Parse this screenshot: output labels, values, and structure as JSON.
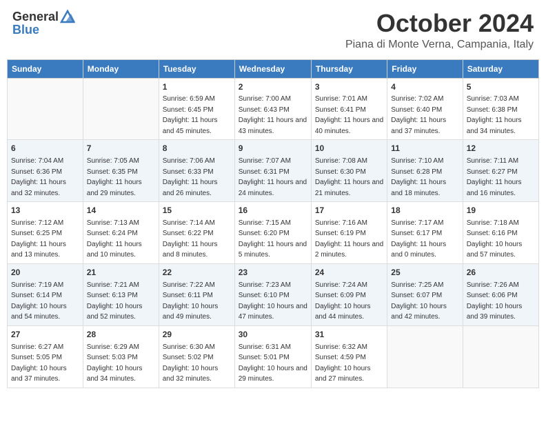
{
  "header": {
    "logo_general": "General",
    "logo_blue": "Blue",
    "month_title": "October 2024",
    "location": "Piana di Monte Verna, Campania, Italy"
  },
  "weekdays": [
    "Sunday",
    "Monday",
    "Tuesday",
    "Wednesday",
    "Thursday",
    "Friday",
    "Saturday"
  ],
  "weeks": [
    [
      {
        "day": "",
        "sunrise": "",
        "sunset": "",
        "daylight": ""
      },
      {
        "day": "",
        "sunrise": "",
        "sunset": "",
        "daylight": ""
      },
      {
        "day": "1",
        "sunrise": "Sunrise: 6:59 AM",
        "sunset": "Sunset: 6:45 PM",
        "daylight": "Daylight: 11 hours and 45 minutes."
      },
      {
        "day": "2",
        "sunrise": "Sunrise: 7:00 AM",
        "sunset": "Sunset: 6:43 PM",
        "daylight": "Daylight: 11 hours and 43 minutes."
      },
      {
        "day": "3",
        "sunrise": "Sunrise: 7:01 AM",
        "sunset": "Sunset: 6:41 PM",
        "daylight": "Daylight: 11 hours and 40 minutes."
      },
      {
        "day": "4",
        "sunrise": "Sunrise: 7:02 AM",
        "sunset": "Sunset: 6:40 PM",
        "daylight": "Daylight: 11 hours and 37 minutes."
      },
      {
        "day": "5",
        "sunrise": "Sunrise: 7:03 AM",
        "sunset": "Sunset: 6:38 PM",
        "daylight": "Daylight: 11 hours and 34 minutes."
      }
    ],
    [
      {
        "day": "6",
        "sunrise": "Sunrise: 7:04 AM",
        "sunset": "Sunset: 6:36 PM",
        "daylight": "Daylight: 11 hours and 32 minutes."
      },
      {
        "day": "7",
        "sunrise": "Sunrise: 7:05 AM",
        "sunset": "Sunset: 6:35 PM",
        "daylight": "Daylight: 11 hours and 29 minutes."
      },
      {
        "day": "8",
        "sunrise": "Sunrise: 7:06 AM",
        "sunset": "Sunset: 6:33 PM",
        "daylight": "Daylight: 11 hours and 26 minutes."
      },
      {
        "day": "9",
        "sunrise": "Sunrise: 7:07 AM",
        "sunset": "Sunset: 6:31 PM",
        "daylight": "Daylight: 11 hours and 24 minutes."
      },
      {
        "day": "10",
        "sunrise": "Sunrise: 7:08 AM",
        "sunset": "Sunset: 6:30 PM",
        "daylight": "Daylight: 11 hours and 21 minutes."
      },
      {
        "day": "11",
        "sunrise": "Sunrise: 7:10 AM",
        "sunset": "Sunset: 6:28 PM",
        "daylight": "Daylight: 11 hours and 18 minutes."
      },
      {
        "day": "12",
        "sunrise": "Sunrise: 7:11 AM",
        "sunset": "Sunset: 6:27 PM",
        "daylight": "Daylight: 11 hours and 16 minutes."
      }
    ],
    [
      {
        "day": "13",
        "sunrise": "Sunrise: 7:12 AM",
        "sunset": "Sunset: 6:25 PM",
        "daylight": "Daylight: 11 hours and 13 minutes."
      },
      {
        "day": "14",
        "sunrise": "Sunrise: 7:13 AM",
        "sunset": "Sunset: 6:24 PM",
        "daylight": "Daylight: 11 hours and 10 minutes."
      },
      {
        "day": "15",
        "sunrise": "Sunrise: 7:14 AM",
        "sunset": "Sunset: 6:22 PM",
        "daylight": "Daylight: 11 hours and 8 minutes."
      },
      {
        "day": "16",
        "sunrise": "Sunrise: 7:15 AM",
        "sunset": "Sunset: 6:20 PM",
        "daylight": "Daylight: 11 hours and 5 minutes."
      },
      {
        "day": "17",
        "sunrise": "Sunrise: 7:16 AM",
        "sunset": "Sunset: 6:19 PM",
        "daylight": "Daylight: 11 hours and 2 minutes."
      },
      {
        "day": "18",
        "sunrise": "Sunrise: 7:17 AM",
        "sunset": "Sunset: 6:17 PM",
        "daylight": "Daylight: 11 hours and 0 minutes."
      },
      {
        "day": "19",
        "sunrise": "Sunrise: 7:18 AM",
        "sunset": "Sunset: 6:16 PM",
        "daylight": "Daylight: 10 hours and 57 minutes."
      }
    ],
    [
      {
        "day": "20",
        "sunrise": "Sunrise: 7:19 AM",
        "sunset": "Sunset: 6:14 PM",
        "daylight": "Daylight: 10 hours and 54 minutes."
      },
      {
        "day": "21",
        "sunrise": "Sunrise: 7:21 AM",
        "sunset": "Sunset: 6:13 PM",
        "daylight": "Daylight: 10 hours and 52 minutes."
      },
      {
        "day": "22",
        "sunrise": "Sunrise: 7:22 AM",
        "sunset": "Sunset: 6:11 PM",
        "daylight": "Daylight: 10 hours and 49 minutes."
      },
      {
        "day": "23",
        "sunrise": "Sunrise: 7:23 AM",
        "sunset": "Sunset: 6:10 PM",
        "daylight": "Daylight: 10 hours and 47 minutes."
      },
      {
        "day": "24",
        "sunrise": "Sunrise: 7:24 AM",
        "sunset": "Sunset: 6:09 PM",
        "daylight": "Daylight: 10 hours and 44 minutes."
      },
      {
        "day": "25",
        "sunrise": "Sunrise: 7:25 AM",
        "sunset": "Sunset: 6:07 PM",
        "daylight": "Daylight: 10 hours and 42 minutes."
      },
      {
        "day": "26",
        "sunrise": "Sunrise: 7:26 AM",
        "sunset": "Sunset: 6:06 PM",
        "daylight": "Daylight: 10 hours and 39 minutes."
      }
    ],
    [
      {
        "day": "27",
        "sunrise": "Sunrise: 6:27 AM",
        "sunset": "Sunset: 5:05 PM",
        "daylight": "Daylight: 10 hours and 37 minutes."
      },
      {
        "day": "28",
        "sunrise": "Sunrise: 6:29 AM",
        "sunset": "Sunset: 5:03 PM",
        "daylight": "Daylight: 10 hours and 34 minutes."
      },
      {
        "day": "29",
        "sunrise": "Sunrise: 6:30 AM",
        "sunset": "Sunset: 5:02 PM",
        "daylight": "Daylight: 10 hours and 32 minutes."
      },
      {
        "day": "30",
        "sunrise": "Sunrise: 6:31 AM",
        "sunset": "Sunset: 5:01 PM",
        "daylight": "Daylight: 10 hours and 29 minutes."
      },
      {
        "day": "31",
        "sunrise": "Sunrise: 6:32 AM",
        "sunset": "Sunset: 4:59 PM",
        "daylight": "Daylight: 10 hours and 27 minutes."
      },
      {
        "day": "",
        "sunrise": "",
        "sunset": "",
        "daylight": ""
      },
      {
        "day": "",
        "sunrise": "",
        "sunset": "",
        "daylight": ""
      }
    ]
  ]
}
